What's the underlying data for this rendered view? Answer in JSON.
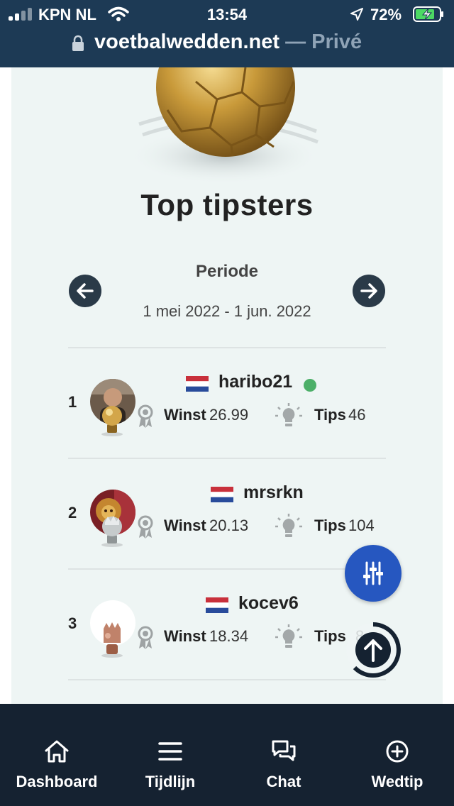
{
  "status_bar": {
    "carrier": "KPN NL",
    "time": "13:54",
    "battery": "72%"
  },
  "browser": {
    "domain": "voetbalwedden.net",
    "mode": "— Privé"
  },
  "page": {
    "title": "Top tipsters",
    "period_label": "Periode",
    "period_range": "1 mei 2022 - 1 jun. 2022"
  },
  "labels": {
    "winst": "Winst",
    "tips": "Tips"
  },
  "tipsters": [
    {
      "rank": "1",
      "name": "haribo21",
      "online": true,
      "winst": "26.99",
      "tips": "46",
      "trophy": "gold"
    },
    {
      "rank": "2",
      "name": "mrsrkn",
      "online": false,
      "winst": "20.13",
      "tips": "104",
      "trophy": "silver"
    },
    {
      "rank": "3",
      "name": "kocev6",
      "online": false,
      "winst": "18.34",
      "tips": "8",
      "trophy": "bronze"
    }
  ],
  "bottom_nav": [
    {
      "label": "Dashboard",
      "icon": "home-icon"
    },
    {
      "label": "Tijdlijn",
      "icon": "menu-icon"
    },
    {
      "label": "Chat",
      "icon": "chat-icon"
    },
    {
      "label": "Wedtip",
      "icon": "plus-circle-icon"
    }
  ],
  "colors": {
    "header_bg": "#1d3a55",
    "nav_bg": "#152231",
    "card_bg": "#eef5f4",
    "fab_blue": "#2657c0",
    "online_green": "#4caf68"
  }
}
